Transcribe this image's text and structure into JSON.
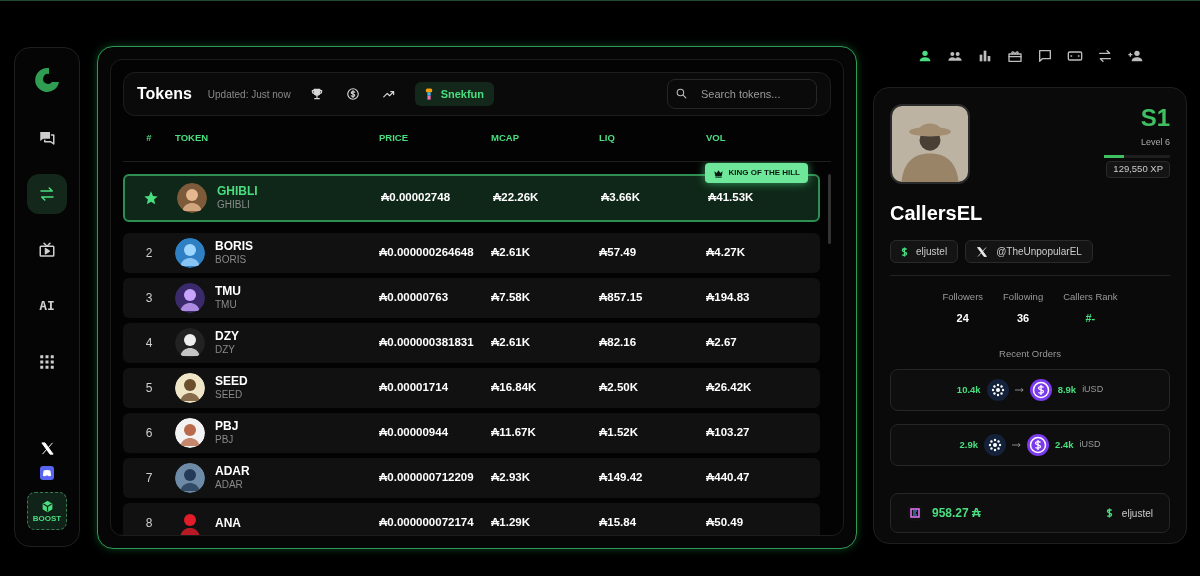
{
  "sidebar": {
    "items": [
      {
        "kind": "chat",
        "selected": false
      },
      {
        "kind": "swap",
        "selected": true
      },
      {
        "kind": "tv",
        "selected": false
      },
      {
        "kind": "text",
        "label": "AI",
        "selected": false
      },
      {
        "kind": "grid",
        "selected": false
      }
    ],
    "boost_label": "BOOST"
  },
  "tokens_header": {
    "title": "Tokens",
    "updated": "Updated: Just now",
    "filters": [
      {
        "kind": "trophy",
        "selected": false
      },
      {
        "kind": "dollar",
        "selected": false
      },
      {
        "kind": "trend",
        "selected": false
      },
      {
        "kind": "snek",
        "label": "Snekfun",
        "selected": true
      }
    ],
    "search": {
      "placeholder": "Search tokens..."
    }
  },
  "table": {
    "columns": [
      "#",
      "TOKEN",
      "PRICE",
      "MCAP",
      "LIQ",
      "VOL"
    ],
    "rows": [
      {
        "kind": "featured",
        "name": "GHIBLI",
        "symbol": "GHIBLI",
        "price": "₳0.00002748",
        "mcap": "₳22.26K",
        "liq": "₳3.66K",
        "vol": "₳41.53K",
        "badge": "KING OF THE HILL",
        "selected": true
      },
      {
        "kind": "ranked",
        "rank": "2",
        "name": "BORIS",
        "symbol": "BORIS",
        "price": "₳0.000000264648",
        "mcap": "₳2.61K",
        "liq": "₳57.49",
        "vol": "₳4.27K",
        "selected": false
      },
      {
        "kind": "ranked",
        "rank": "3",
        "name": "TMU",
        "symbol": "TMU",
        "price": "₳0.00000763",
        "mcap": "₳7.58K",
        "liq": "₳857.15",
        "vol": "₳194.83",
        "selected": false
      },
      {
        "kind": "ranked",
        "rank": "4",
        "name": "DZY",
        "symbol": "DZY",
        "price": "₳0.000000381831",
        "mcap": "₳2.61K",
        "liq": "₳82.16",
        "vol": "₳2.67",
        "selected": false
      },
      {
        "kind": "ranked",
        "rank": "5",
        "name": "SEED",
        "symbol": "SEED",
        "price": "₳0.00001714",
        "mcap": "₳16.84K",
        "liq": "₳2.50K",
        "vol": "₳26.42K",
        "selected": false
      },
      {
        "kind": "ranked",
        "rank": "6",
        "name": "PBJ",
        "symbol": "PBJ",
        "price": "₳0.00000944",
        "mcap": "₳11.67K",
        "liq": "₳1.52K",
        "vol": "₳103.27",
        "selected": false
      },
      {
        "kind": "ranked",
        "rank": "7",
        "name": "ADAR",
        "symbol": "ADAR",
        "price": "₳0.000000712209",
        "mcap": "₳2.93K",
        "liq": "₳149.42",
        "vol": "₳440.47",
        "selected": false
      },
      {
        "kind": "ranked",
        "rank": "8",
        "name": "ANA",
        "price": "₳0.000000072174",
        "mcap": "₳1.29K",
        "liq": "₳15.84",
        "vol": "₳50.49",
        "selected": false
      }
    ]
  },
  "profile_tabs": [
    {
      "kind": "person",
      "selected": true
    },
    {
      "kind": "people",
      "selected": false
    },
    {
      "kind": "chart",
      "selected": false
    },
    {
      "kind": "gift",
      "selected": false
    },
    {
      "kind": "message",
      "selected": false
    },
    {
      "kind": "card",
      "selected": false
    },
    {
      "kind": "swap",
      "selected": false
    },
    {
      "kind": "add-person",
      "selected": false
    }
  ],
  "profile": {
    "season": "S1",
    "level_label": "Level 6",
    "xp_bar": {
      "level": 0.3
    },
    "xp": "129,550 XP",
    "name": "CallersEL",
    "handles": [
      {
        "kind": "dollar",
        "label": "eljustel"
      },
      {
        "kind": "x",
        "label": "@TheUnpopularEL"
      }
    ],
    "stats": [
      {
        "label": "Followers",
        "value": "24",
        "highlight": false
      },
      {
        "label": "Following",
        "value": "36",
        "highlight": false
      },
      {
        "label": "Callers Rank",
        "value": "#-",
        "highlight": true
      }
    ],
    "recent_orders_title": "Recent Orders",
    "orders": [
      {
        "from": "10.4k",
        "to": "8.9k",
        "to_unit": "iUSD"
      },
      {
        "from": "2.9k",
        "to": "2.4k",
        "to_unit": "iUSD"
      }
    ],
    "balance": {
      "amount": "958.27 ₳",
      "handle": "eljustel"
    }
  }
}
